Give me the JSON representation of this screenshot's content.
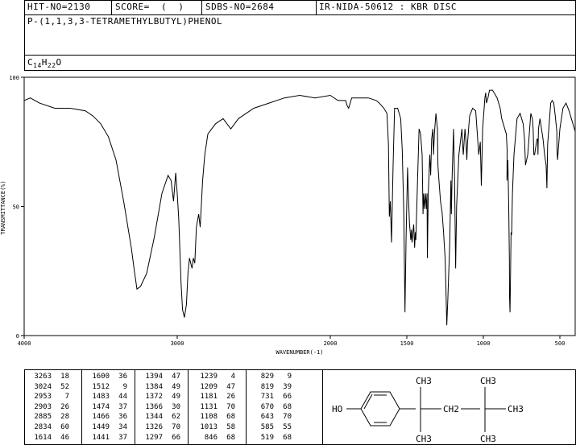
{
  "header": {
    "hit_no": "HIT-NO=2130",
    "score": "SCORE=  (  )",
    "sdbs_no": "SDBS-NO=2684",
    "method": "IR-NIDA-50612 : KBR DISC"
  },
  "compound": {
    "name": "P-(1,1,3,3-TETRAMETHYLBUTYL)PHENOL",
    "formula_parts": [
      "C",
      "14",
      "H",
      "22",
      "O"
    ]
  },
  "chart_data": {
    "type": "line",
    "ylabel": "TRANSMITTANCE(%)",
    "xlabel": "WAVENUMBER(-1)",
    "xlim": [
      4000,
      400
    ],
    "ylim": [
      0,
      100
    ],
    "xticks": [
      4000,
      3000,
      2000,
      1500,
      1000,
      500
    ],
    "xtick_labels": [
      "4000",
      "3000",
      "2000",
      "1500",
      "1000",
      "500"
    ],
    "yticks": [
      0,
      50,
      100
    ],
    "ytick_labels": [
      "0",
      "50",
      "100"
    ],
    "grid": false,
    "series": [
      {
        "x": [
          4000,
          3960,
          3900,
          3800,
          3700,
          3600,
          3550,
          3500,
          3450,
          3400,
          3350,
          3300,
          3280,
          3263,
          3240,
          3200,
          3150,
          3100,
          3060,
          3040,
          3024,
          3010,
          3000,
          2990,
          2975,
          2965,
          2953,
          2940,
          2930,
          2920,
          2903,
          2895,
          2885,
          2875,
          2860,
          2850,
          2834,
          2820,
          2800,
          2750,
          2700,
          2650,
          2600,
          2500,
          2400,
          2300,
          2200,
          2100,
          2000,
          1950,
          1900,
          1890,
          1880,
          1870,
          1860,
          1800,
          1750,
          1700,
          1680,
          1650,
          1630,
          1620,
          1614,
          1608,
          1600,
          1590,
          1580,
          1560,
          1540,
          1530,
          1520,
          1512,
          1505,
          1495,
          1490,
          1483,
          1478,
          1474,
          1470,
          1466,
          1460,
          1455,
          1449,
          1445,
          1441,
          1430,
          1420,
          1410,
          1400,
          1394,
          1390,
          1384,
          1378,
          1372,
          1368,
          1366,
          1360,
          1350,
          1344,
          1338,
          1330,
          1326,
          1320,
          1310,
          1300,
          1297,
          1290,
          1280,
          1270,
          1260,
          1250,
          1245,
          1239,
          1232,
          1220,
          1212,
          1209,
          1205,
          1195,
          1188,
          1181,
          1175,
          1160,
          1140,
          1135,
          1131,
          1127,
          1120,
          1112,
          1108,
          1104,
          1090,
          1070,
          1050,
          1030,
          1020,
          1013,
          1005,
          990,
          985,
          980,
          970,
          960,
          950,
          940,
          930,
          920,
          910,
          900,
          890,
          880,
          870,
          860,
          850,
          845,
          846,
          840,
          835,
          830,
          829,
          826,
          822,
          819,
          815,
          810,
          800,
          780,
          760,
          740,
          731,
          725,
          710,
          700,
          690,
          680,
          675,
          670,
          665,
          650,
          645,
          643,
          640,
          630,
          620,
          610,
          600,
          590,
          585,
          580,
          570,
          560,
          550,
          540,
          530,
          520,
          519,
          515,
          500,
          480,
          460,
          440,
          420,
          400
        ],
        "y": [
          91,
          92,
          90,
          88,
          88,
          87,
          85,
          82,
          77,
          68,
          52,
          34,
          25,
          18,
          19,
          24,
          38,
          55,
          62,
          60,
          52,
          63,
          55,
          45,
          20,
          10,
          7,
          12,
          24,
          30,
          26,
          30,
          28,
          42,
          47,
          42,
          60,
          70,
          78,
          82,
          84,
          80,
          84,
          88,
          90,
          92,
          93,
          92,
          93,
          91,
          91,
          89,
          88,
          90,
          92,
          92,
          92,
          91,
          90,
          88,
          86,
          74,
          46,
          52,
          36,
          65,
          88,
          88,
          84,
          72,
          48,
          9,
          38,
          65,
          55,
          44,
          40,
          37,
          41,
          36,
          40,
          43,
          34,
          40,
          37,
          60,
          80,
          78,
          70,
          47,
          55,
          49,
          55,
          49,
          55,
          30,
          55,
          70,
          62,
          76,
          80,
          70,
          78,
          86,
          80,
          66,
          60,
          52,
          48,
          40,
          30,
          20,
          4,
          14,
          35,
          60,
          47,
          60,
          80,
          60,
          26,
          50,
          70,
          80,
          74,
          70,
          74,
          80,
          74,
          68,
          74,
          85,
          88,
          87,
          70,
          75,
          58,
          80,
          92,
          94,
          90,
          92,
          95,
          95,
          95,
          94,
          93,
          92,
          90,
          88,
          84,
          82,
          80,
          78,
          72,
          60,
          68,
          52,
          30,
          15,
          9,
          25,
          40,
          39,
          55,
          70,
          84,
          86,
          82,
          76,
          66,
          70,
          78,
          86,
          84,
          80,
          70,
          70,
          76,
          76,
          70,
          80,
          84,
          80,
          76,
          70,
          66,
          57,
          74,
          82,
          90,
          91,
          90,
          85,
          79,
          72,
          68,
          80,
          88,
          90,
          87,
          83,
          79
        ]
      }
    ]
  },
  "peak_table": {
    "columns": [
      [
        [
          "3263",
          "18"
        ],
        [
          "3024",
          "52"
        ],
        [
          "2953",
          "7"
        ],
        [
          "2903",
          "26"
        ],
        [
          "2885",
          "28"
        ],
        [
          "2834",
          "60"
        ],
        [
          "1614",
          "46"
        ]
      ],
      [
        [
          "1600",
          "36"
        ],
        [
          "1512",
          "9"
        ],
        [
          "1483",
          "44"
        ],
        [
          "1474",
          "37"
        ],
        [
          "1466",
          "36"
        ],
        [
          "1449",
          "34"
        ],
        [
          "1441",
          "37"
        ]
      ],
      [
        [
          "1394",
          "47"
        ],
        [
          "1384",
          "49"
        ],
        [
          "1372",
          "49"
        ],
        [
          "1366",
          "30"
        ],
        [
          "1344",
          "62"
        ],
        [
          "1326",
          "70"
        ],
        [
          "1297",
          "66"
        ]
      ],
      [
        [
          "1239",
          "4"
        ],
        [
          "1209",
          "47"
        ],
        [
          "1181",
          "26"
        ],
        [
          "1131",
          "70"
        ],
        [
          "1108",
          "68"
        ],
        [
          "1013",
          "58"
        ],
        [
          "846",
          "68"
        ]
      ],
      [
        [
          "829",
          "9"
        ],
        [
          "819",
          "39"
        ],
        [
          "731",
          "66"
        ],
        [
          "670",
          "68"
        ],
        [
          "643",
          "70"
        ],
        [
          "585",
          "55"
        ],
        [
          "519",
          "68"
        ]
      ]
    ]
  },
  "structure": {
    "ho_label": "HO",
    "ch3_top1": "CH3",
    "ch3_top2": "CH3",
    "ch3_right": "CH3",
    "ch3_bottom1": "CH3",
    "ch3_bottom2": "CH3",
    "ch2_label": "CH2"
  }
}
